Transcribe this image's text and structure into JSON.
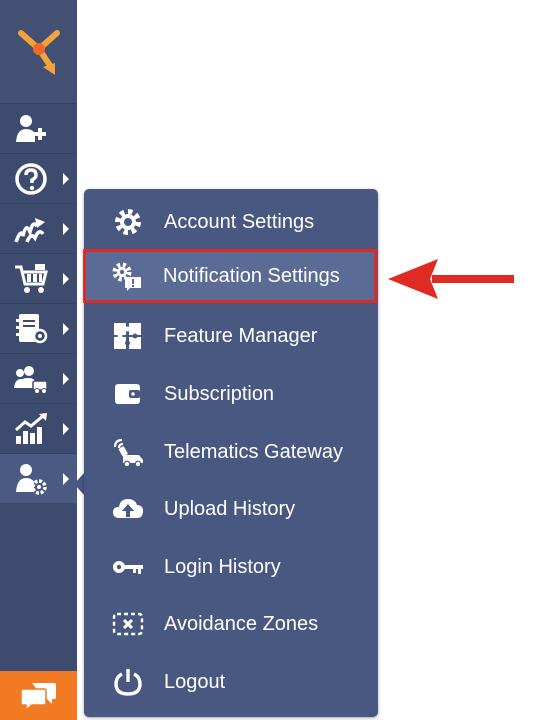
{
  "sidebar": {
    "logo_icon": "route4me-logo",
    "items": [
      {
        "name": "add-user",
        "icon": "add-user-icon"
      },
      {
        "name": "help",
        "icon": "help-circle-icon"
      },
      {
        "name": "routes",
        "icon": "routes-icon"
      },
      {
        "name": "marketplace",
        "icon": "cart-icon"
      },
      {
        "name": "address-book",
        "icon": "address-book-icon"
      },
      {
        "name": "team",
        "icon": "team-vehicle-icon"
      },
      {
        "name": "analytics",
        "icon": "analytics-icon"
      },
      {
        "name": "settings",
        "icon": "user-settings-icon"
      }
    ],
    "chat_icon": "chat-icon"
  },
  "menu": {
    "items": [
      {
        "label": "Account Settings",
        "icon": "gear-icon"
      },
      {
        "label": "Notification Settings",
        "icon": "notification-settings-icon"
      },
      {
        "label": "Feature Manager",
        "icon": "puzzle-icon"
      },
      {
        "label": "Subscription",
        "icon": "wallet-icon"
      },
      {
        "label": "Telematics Gateway",
        "icon": "telematics-icon"
      },
      {
        "label": "Upload History",
        "icon": "cloud-upload-icon"
      },
      {
        "label": "Login History",
        "icon": "key-icon"
      },
      {
        "label": "Avoidance Zones",
        "icon": "avoidance-zone-icon"
      },
      {
        "label": "Logout",
        "icon": "power-icon"
      }
    ]
  },
  "colors": {
    "sidebar": "#3d4b6e",
    "menu": "#485880",
    "highlight": "#5a6b95",
    "accent_orange": "#f27a22",
    "annotation_red": "#e02a24"
  }
}
